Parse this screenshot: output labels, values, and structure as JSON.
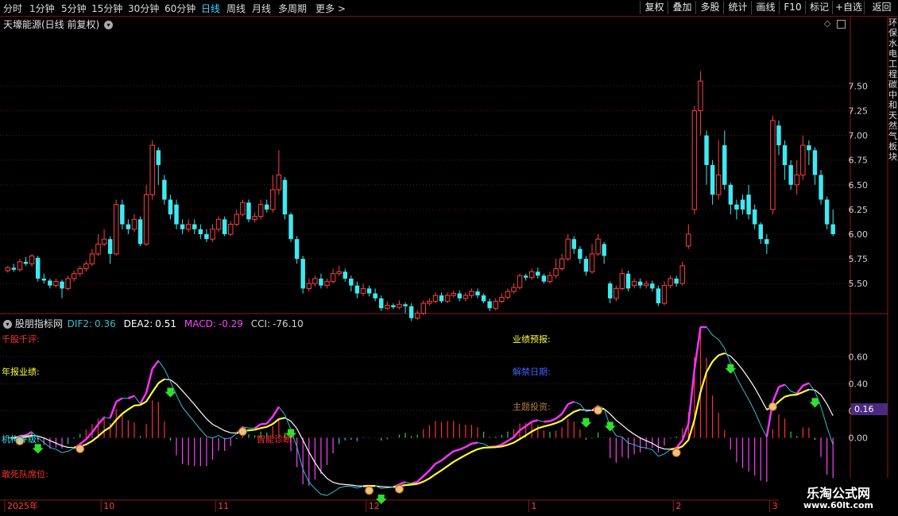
{
  "periods": [
    {
      "label": "分时",
      "active": false
    },
    {
      "label": "1分钟",
      "active": false
    },
    {
      "label": "5分钟",
      "active": false
    },
    {
      "label": "15分钟",
      "active": false
    },
    {
      "label": "30分钟",
      "active": false
    },
    {
      "label": "60分钟",
      "active": false
    },
    {
      "label": "日线",
      "active": true
    },
    {
      "label": "周线",
      "active": false
    },
    {
      "label": "月线",
      "active": false
    },
    {
      "label": "多周期",
      "active": false
    },
    {
      "label": "更多 >",
      "active": false
    }
  ],
  "toolbar": [
    "复权",
    "叠加",
    "多股",
    "统计",
    "画线",
    "F10",
    "标记",
    "+自选",
    "返回"
  ],
  "chart_title": "天壕能源(日线 前复权)",
  "indicator": {
    "name": "股朋指标网",
    "dif_label": "DIF2:",
    "dif": "0.36",
    "dea_label": "DEA2:",
    "dea": "0.51",
    "macd_label": "MACD:",
    "macd": "-0.29",
    "cci_label": "CCI:",
    "cci": "-76.10",
    "current_value_badge": "0.16",
    "labels": [
      {
        "text": "千股千评:",
        "color": "#ff3030"
      },
      {
        "text": "年报业绩:",
        "color": "#ffff40"
      },
      {
        "text": "机构评级:",
        "color": "#40e0ff"
      },
      {
        "text": "敢死队席位:",
        "color": "#ff3030"
      },
      {
        "text": "智能诊断:",
        "color": "#ff3030"
      },
      {
        "text": "业绩预报:",
        "color": "#ffff40"
      },
      {
        "text": "解禁日期:",
        "color": "#4040ff"
      },
      {
        "text": "主题投资:",
        "color": "#b08040"
      }
    ]
  },
  "sidebar_text": "环保水电工程碳中和天然气板块",
  "watermark": {
    "line1": "乐淘公式网",
    "line2": "www.60lt.com"
  },
  "colors": {
    "up": "#ff4040",
    "down": "#40e8f0",
    "grid": "#5a1a1a",
    "axis": "#d0d0d0"
  },
  "chart_data": [
    {
      "type": "candlestick",
      "title": "天壕能源(日线 前复权)",
      "y_ticks": [
        "7.50",
        "7.25",
        "7.00",
        "6.75",
        "6.50",
        "6.25",
        "6.00",
        "5.75",
        "5.50"
      ],
      "ylim": [
        5.22,
        8.05
      ],
      "x_ticks": [
        {
          "label": "2025年",
          "index": 0
        },
        {
          "label": "10",
          "index": 16
        },
        {
          "label": "11",
          "index": 35
        },
        {
          "label": "12",
          "index": 60
        },
        {
          "label": "1",
          "index": 87
        },
        {
          "label": "2",
          "index": 111
        },
        {
          "label": "3",
          "index": 127
        }
      ],
      "candles": [
        [
          5.63,
          5.66,
          5.68,
          5.61
        ],
        [
          5.66,
          5.64,
          5.7,
          5.62
        ],
        [
          5.64,
          5.72,
          5.75,
          5.62
        ],
        [
          5.72,
          5.7,
          5.77,
          5.68
        ],
        [
          5.7,
          5.78,
          5.8,
          5.67
        ],
        [
          5.76,
          5.55,
          5.78,
          5.52
        ],
        [
          5.55,
          5.53,
          5.6,
          5.5
        ],
        [
          5.53,
          5.48,
          5.55,
          5.45
        ],
        [
          5.48,
          5.52,
          5.55,
          5.46
        ],
        [
          5.52,
          5.45,
          5.54,
          5.35
        ],
        [
          5.45,
          5.55,
          5.58,
          5.43
        ],
        [
          5.55,
          5.6,
          5.63,
          5.52
        ],
        [
          5.6,
          5.65,
          5.68,
          5.57
        ],
        [
          5.65,
          5.7,
          5.73,
          5.62
        ],
        [
          5.7,
          5.8,
          5.85,
          5.68
        ],
        [
          5.8,
          5.9,
          6.0,
          5.78
        ],
        [
          5.9,
          5.95,
          6.05,
          5.88
        ],
        [
          5.95,
          5.8,
          5.98,
          5.7
        ],
        [
          5.8,
          6.3,
          6.35,
          5.78
        ],
        [
          6.3,
          6.1,
          6.35,
          6.05
        ],
        [
          6.1,
          6.05,
          6.15,
          6.0
        ],
        [
          6.05,
          6.15,
          6.2,
          6.02
        ],
        [
          6.15,
          5.9,
          6.18,
          5.88
        ],
        [
          5.9,
          6.4,
          6.5,
          5.88
        ],
        [
          6.4,
          6.9,
          6.95,
          6.35
        ],
        [
          6.85,
          6.7,
          6.88,
          6.5
        ],
        [
          6.55,
          6.35,
          6.6,
          6.3
        ],
        [
          6.35,
          6.2,
          6.4,
          6.15
        ],
        [
          6.3,
          6.1,
          6.35,
          6.05
        ],
        [
          6.1,
          6.05,
          6.15,
          6.0
        ],
        [
          6.05,
          6.1,
          6.15,
          6.02
        ],
        [
          6.1,
          6.05,
          6.15,
          6.0
        ],
        [
          6.05,
          6.0,
          6.1,
          5.95
        ],
        [
          6.0,
          5.95,
          6.05,
          5.92
        ],
        [
          5.95,
          6.05,
          6.1,
          5.92
        ],
        [
          6.05,
          6.15,
          6.18,
          6.02
        ],
        [
          6.15,
          6.0,
          6.18,
          5.98
        ],
        [
          6.0,
          6.1,
          6.13,
          5.98
        ],
        [
          6.1,
          6.2,
          6.25,
          6.08
        ],
        [
          6.2,
          6.32,
          6.35,
          6.18
        ],
        [
          6.32,
          6.15,
          6.35,
          6.12
        ],
        [
          6.15,
          6.18,
          6.22,
          6.12
        ],
        [
          6.18,
          6.3,
          6.35,
          6.15
        ],
        [
          6.3,
          6.25,
          6.35,
          6.22
        ],
        [
          6.25,
          6.45,
          6.6,
          6.22
        ],
        [
          6.45,
          6.6,
          6.85,
          6.4
        ],
        [
          6.55,
          6.2,
          6.58,
          6.15
        ],
        [
          6.2,
          5.95,
          6.22,
          5.92
        ],
        [
          5.95,
          5.75,
          5.98,
          5.7
        ],
        [
          5.75,
          5.45,
          5.78,
          5.4
        ],
        [
          5.45,
          5.5,
          5.55,
          5.42
        ],
        [
          5.5,
          5.55,
          5.58,
          5.47
        ],
        [
          5.55,
          5.48,
          5.6,
          5.45
        ],
        [
          5.48,
          5.52,
          5.55,
          5.45
        ],
        [
          5.52,
          5.6,
          5.65,
          5.5
        ],
        [
          5.6,
          5.62,
          5.68,
          5.58
        ],
        [
          5.62,
          5.55,
          5.65,
          5.52
        ],
        [
          5.55,
          5.48,
          5.58,
          5.42
        ],
        [
          5.48,
          5.4,
          5.52,
          5.35
        ],
        [
          5.4,
          5.45,
          5.5,
          5.37
        ],
        [
          5.45,
          5.4,
          5.48,
          5.37
        ],
        [
          5.4,
          5.35,
          5.45,
          5.32
        ],
        [
          5.35,
          5.25,
          5.38,
          5.22
        ],
        [
          5.25,
          5.28,
          5.32,
          5.23
        ],
        [
          5.28,
          5.26,
          5.3,
          5.24
        ],
        [
          5.26,
          5.29,
          5.33,
          5.24
        ],
        [
          5.29,
          5.27,
          5.31,
          5.2
        ],
        [
          5.27,
          5.15,
          5.3,
          5.12
        ],
        [
          5.15,
          5.2,
          5.23,
          5.13
        ],
        [
          5.2,
          5.3,
          5.33,
          5.18
        ],
        [
          5.3,
          5.32,
          5.35,
          5.28
        ],
        [
          5.32,
          5.38,
          5.41,
          5.3
        ],
        [
          5.38,
          5.32,
          5.41,
          5.3
        ],
        [
          5.32,
          5.38,
          5.41,
          5.3
        ],
        [
          5.38,
          5.4,
          5.43,
          5.36
        ],
        [
          5.4,
          5.35,
          5.43,
          5.32
        ],
        [
          5.35,
          5.38,
          5.41,
          5.32
        ],
        [
          5.38,
          5.42,
          5.45,
          5.35
        ],
        [
          5.42,
          5.38,
          5.45,
          5.35
        ],
        [
          5.38,
          5.32,
          5.4,
          5.3
        ],
        [
          5.32,
          5.25,
          5.35,
          5.22
        ],
        [
          5.25,
          5.32,
          5.35,
          5.23
        ],
        [
          5.32,
          5.36,
          5.4,
          5.3
        ],
        [
          5.36,
          5.42,
          5.45,
          5.34
        ],
        [
          5.42,
          5.46,
          5.5,
          5.4
        ],
        [
          5.46,
          5.58,
          5.6,
          5.44
        ],
        [
          5.58,
          5.56,
          5.6,
          5.53
        ],
        [
          5.56,
          5.62,
          5.65,
          5.54
        ],
        [
          5.62,
          5.58,
          5.66,
          5.55
        ],
        [
          5.58,
          5.52,
          5.6,
          5.5
        ],
        [
          5.52,
          5.58,
          5.62,
          5.5
        ],
        [
          5.58,
          5.65,
          5.75,
          5.55
        ],
        [
          5.65,
          5.75,
          5.8,
          5.63
        ],
        [
          5.75,
          5.95,
          6.0,
          5.73
        ],
        [
          5.95,
          5.85,
          5.98,
          5.8
        ],
        [
          5.85,
          5.75,
          5.88,
          5.7
        ],
        [
          5.75,
          5.62,
          5.78,
          5.58
        ],
        [
          5.62,
          5.8,
          5.9,
          5.6
        ],
        [
          5.8,
          5.95,
          6.0,
          5.78
        ],
        [
          5.9,
          5.78,
          5.92,
          5.7
        ],
        [
          5.5,
          5.35,
          5.52,
          5.3
        ],
        [
          5.35,
          5.45,
          5.48,
          5.32
        ],
        [
          5.45,
          5.6,
          5.65,
          5.43
        ],
        [
          5.6,
          5.45,
          5.63,
          5.42
        ],
        [
          5.48,
          5.52,
          5.55,
          5.45
        ],
        [
          5.52,
          5.48,
          5.55,
          5.45
        ],
        [
          5.48,
          5.5,
          5.53,
          5.45
        ],
        [
          5.5,
          5.45,
          5.53,
          5.42
        ],
        [
          5.45,
          5.3,
          5.48,
          5.27
        ],
        [
          5.3,
          5.48,
          5.52,
          5.28
        ],
        [
          5.48,
          5.55,
          5.58,
          5.45
        ],
        [
          5.55,
          5.5,
          5.58,
          5.47
        ],
        [
          5.5,
          5.68,
          5.72,
          5.48
        ],
        [
          5.88,
          6.0,
          6.1,
          5.85
        ],
        [
          6.25,
          7.25,
          7.3,
          6.2
        ],
        [
          7.25,
          7.55,
          7.65,
          7.0
        ],
        [
          7.0,
          6.7,
          7.05,
          6.5
        ],
        [
          6.7,
          6.4,
          6.75,
          6.3
        ],
        [
          6.4,
          6.6,
          6.95,
          6.35
        ],
        [
          6.9,
          6.5,
          7.05,
          6.45
        ],
        [
          6.5,
          6.3,
          6.52,
          6.2
        ],
        [
          6.3,
          6.25,
          6.35,
          6.15
        ],
        [
          6.35,
          6.25,
          6.4,
          6.2
        ],
        [
          6.4,
          6.2,
          6.5,
          6.15
        ],
        [
          6.25,
          6.1,
          6.3,
          6.05
        ],
        [
          6.1,
          5.95,
          6.12,
          5.9
        ],
        [
          5.95,
          5.9,
          6.0,
          5.8
        ],
        [
          6.25,
          7.15,
          7.2,
          6.2
        ],
        [
          7.1,
          6.9,
          7.15,
          6.8
        ],
        [
          6.9,
          6.7,
          6.95,
          6.55
        ],
        [
          6.7,
          6.5,
          6.75,
          6.45
        ],
        [
          6.5,
          6.6,
          6.75,
          6.4
        ],
        [
          6.6,
          6.9,
          7.0,
          6.55
        ],
        [
          6.9,
          6.85,
          6.95,
          6.7
        ],
        [
          6.85,
          6.6,
          6.88,
          6.5
        ],
        [
          6.6,
          6.35,
          6.65,
          6.3
        ],
        [
          6.35,
          6.1,
          6.38,
          6.05
        ],
        [
          6.1,
          6.0,
          6.25,
          5.98
        ]
      ]
    },
    {
      "type": "line",
      "title": "股朋指标网",
      "y_ticks": [
        "0.60",
        "0.40",
        "0.20",
        "0.00"
      ],
      "ylim": [
        -0.45,
        0.82
      ]
    }
  ]
}
